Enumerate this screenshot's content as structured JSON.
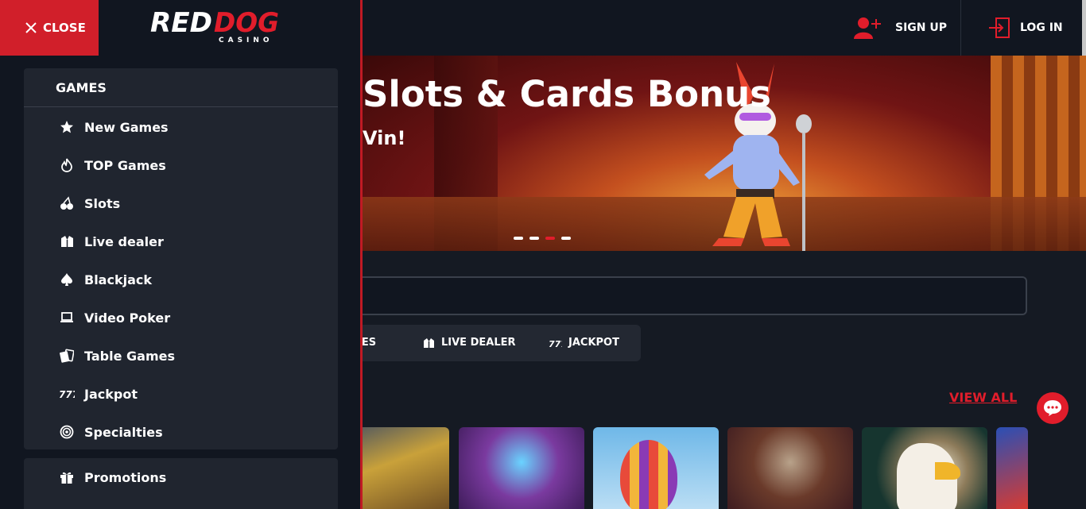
{
  "header": {
    "signup_label": "SIGN UP",
    "login_label": "LOG IN"
  },
  "drawer": {
    "close_label": "CLOSE",
    "logo": {
      "red": "RED",
      "white": "DOG",
      "tagline": "CASINO"
    },
    "games_title": "GAMES",
    "games_items": [
      {
        "label": "New Games",
        "icon": "star-icon"
      },
      {
        "label": "TOP Games",
        "icon": "flame-icon"
      },
      {
        "label": "Slots",
        "icon": "cherry-icon"
      },
      {
        "label": "Live dealer",
        "icon": "dealer-icon"
      },
      {
        "label": "Blackjack",
        "icon": "spade-icon"
      },
      {
        "label": "Video Poker",
        "icon": "laptop-icon"
      },
      {
        "label": "Table Games",
        "icon": "cards-icon"
      },
      {
        "label": "Jackpot",
        "icon": "sevens-icon"
      },
      {
        "label": "Specialties",
        "icon": "target-icon"
      }
    ],
    "promotions_label": "Promotions"
  },
  "banner": {
    "title": "Slots & Cards Bonus",
    "subtitle": "Vin!",
    "dots": 4,
    "active_dot": 2
  },
  "tabs": {
    "partial_label": "IES",
    "live_dealer_label": "LIVE DEALER",
    "jackpot_label": "JACKPOT"
  },
  "section": {
    "view_all_label": "VIEW ALL"
  },
  "colors": {
    "brand_red": "#e11d2b",
    "panel_bg": "#20252f",
    "page_bg": "#151a23"
  }
}
